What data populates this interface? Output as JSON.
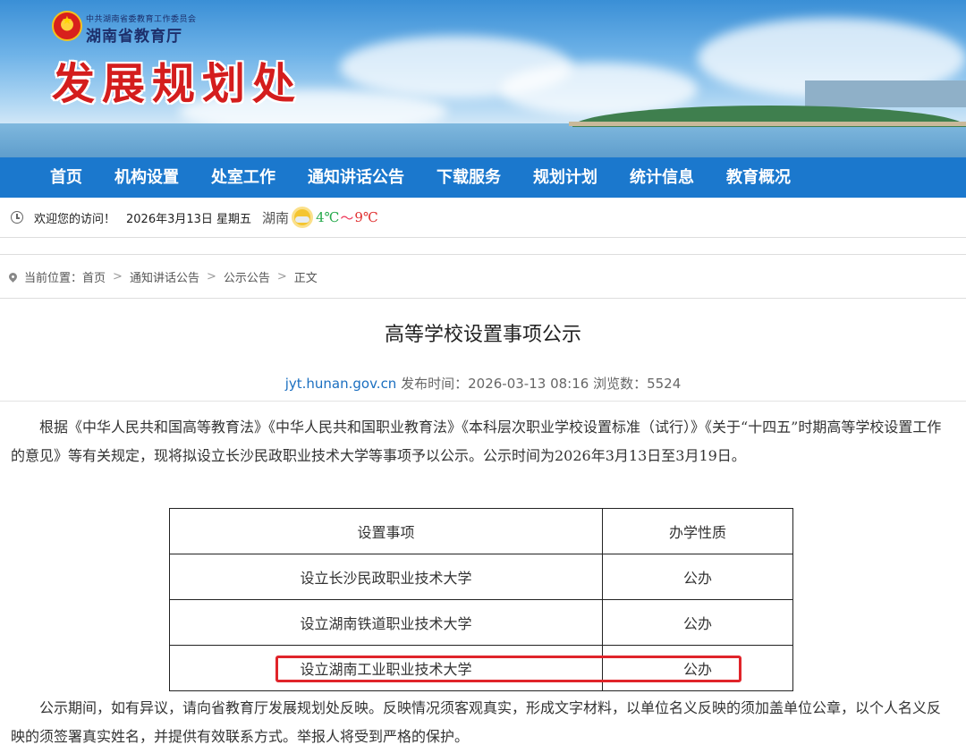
{
  "banner": {
    "dept_small": "中共湖南省委教育工作委员会",
    "dept": "湖南省教育厅",
    "office": "发展规划处"
  },
  "nav": {
    "items": [
      "首页",
      "机构设置",
      "处室工作",
      "通知讲话公告",
      "下载服务",
      "规划计划",
      "统计信息",
      "教育概况"
    ]
  },
  "welcome": {
    "text": "欢迎您的访问！",
    "date": "2026年3月13日 星期五",
    "city": "湖南",
    "temp_low": "4℃",
    "tilde": "～",
    "temp_high": "9℃"
  },
  "breadcrumb": {
    "label": "当前位置：",
    "items": [
      "首页",
      "通知讲话公告",
      "公示公告",
      "正文"
    ],
    "separator": ">"
  },
  "article": {
    "title": "高等学校设置事项公示",
    "site": "jyt.hunan.gov.cn",
    "publish_label": "发布时间：",
    "publish_time": "2026-03-13 08:16",
    "views_label": "浏览数：",
    "views": "5524",
    "para1": "根据《中华人民共和国高等教育法》《中华人民共和国职业教育法》《本科层次职业学校设置标准（试行）》《关于“十四五”时期高等学校设置工作的意见》等有关规定，现将拟设立长沙民政职业技术大学等事项予以公示。公示时间为2026年3月13日至3月19日。",
    "table": {
      "headers": [
        "设置事项",
        "办学性质"
      ],
      "rows": [
        [
          "设立长沙民政职业技术大学",
          "公办"
        ],
        [
          "设立湖南铁道职业技术大学",
          "公办"
        ],
        [
          "设立湖南工业职业技术大学",
          "公办"
        ]
      ]
    },
    "para2": "公示期间，如有异议，请向省教育厅发展规划处反映。反映情况须客观真实，形成文字材料，以单位名义反映的须加盖单位公章，以个人名义反映的须签署真实姓名，并提供有效联系方式。举报人将受到严格的保护。"
  },
  "colors": {
    "nav_bg": "#1b78cd",
    "office_title": "#d41d1d",
    "highlight": "#e0242a",
    "site_link": "#1b6fc0"
  }
}
